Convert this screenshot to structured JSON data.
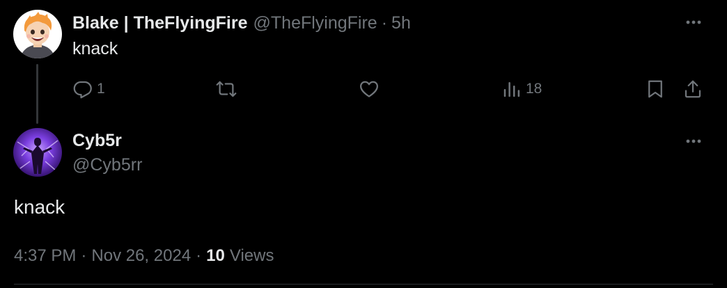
{
  "colors": {
    "background": "#000000",
    "text_primary": "#e7e9ea",
    "text_secondary": "#71767b",
    "divider": "#2f3336"
  },
  "parent_tweet": {
    "display_name": "Blake | TheFlyingFire",
    "handle": "@TheFlyingFire",
    "separator": "·",
    "time": "5h",
    "text": "knack",
    "avatar_icon": "cartoon-avatar",
    "more_icon": "more-horizontal-icon",
    "actions": {
      "reply": {
        "icon": "reply-icon",
        "count": "1"
      },
      "retweet": {
        "icon": "retweet-icon",
        "count": ""
      },
      "like": {
        "icon": "heart-icon",
        "count": ""
      },
      "views": {
        "icon": "views-icon",
        "count": "18"
      },
      "bookmark": {
        "icon": "bookmark-icon"
      },
      "share": {
        "icon": "share-icon"
      }
    }
  },
  "main_tweet": {
    "display_name": "Cyb5r",
    "handle": "@Cyb5rr",
    "text": "knack",
    "avatar_icon": "purple-figure-avatar",
    "more_icon": "more-horizontal-icon",
    "time": "4:37 PM",
    "separator": "·",
    "date": "Nov 26, 2024",
    "views_count": "10",
    "views_label": "Views"
  }
}
